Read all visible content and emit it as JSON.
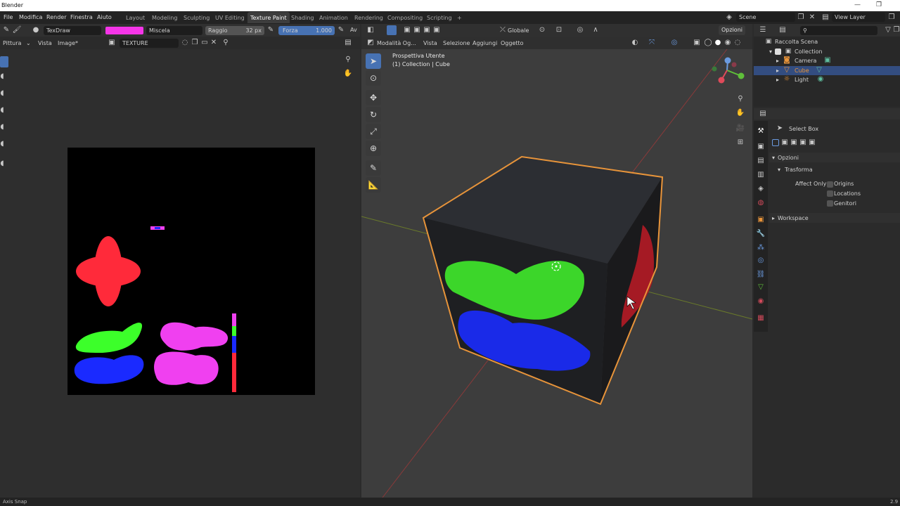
{
  "window": {
    "title": "Blender",
    "controls": [
      "—",
      "❐"
    ]
  },
  "menubar": {
    "menus": [
      "File",
      "Modifica",
      "Render",
      "Finestra",
      "Aiuto"
    ],
    "workspaces": [
      "Layout",
      "Modeling",
      "Sculpting",
      "UV Editing",
      "Texture Paint",
      "Shading",
      "Animation",
      "Rendering",
      "Compositing",
      "Scripting"
    ],
    "add_tab": "+",
    "scene": "Scene",
    "view_layer": "View Layer"
  },
  "image_editor": {
    "brush_name": "TexDraw",
    "brush_color": "#f535e8",
    "blend": "Miscela",
    "radius_label": "Raggio",
    "radius_value": "32 px",
    "strength_label": "Forza",
    "strength_value": "1.000",
    "strength_fraction": 1.0,
    "extra": "Av",
    "mode": "Pittura",
    "view": "Vista",
    "image_menu": "Image*",
    "image_name": "TEXTURE"
  },
  "viewport": {
    "mode": "Modalità Og...",
    "menus": [
      "Vista",
      "Selezione",
      "Aggiungi",
      "Oggetto"
    ],
    "orientation": "Globale",
    "options": "Opzioni",
    "overlay_line1": "Prospettiva Utente",
    "overlay_line2": "(1) Collection | Cube"
  },
  "outliner": {
    "root": "Raccolta Scena",
    "collection": "Collection",
    "items": [
      "Camera",
      "Cube",
      "Light"
    ],
    "selected": "Cube"
  },
  "properties": {
    "tool": "Select Box",
    "section_options": "Opzioni",
    "subsection": "Trasforma",
    "affect_only": "Affect Only",
    "checks": [
      "Origins",
      "Locations",
      "Genitori"
    ],
    "workspace": "Workspace"
  },
  "status": {
    "left": "Axis Snap",
    "right": "2.9"
  },
  "colors": {
    "accent": "#4772b3",
    "selection_outline": "#e8943a",
    "paint_red": "#ff2a3a",
    "paint_green": "#3cff2a",
    "paint_blue": "#1a2aff",
    "paint_pink": "#f040f0"
  }
}
